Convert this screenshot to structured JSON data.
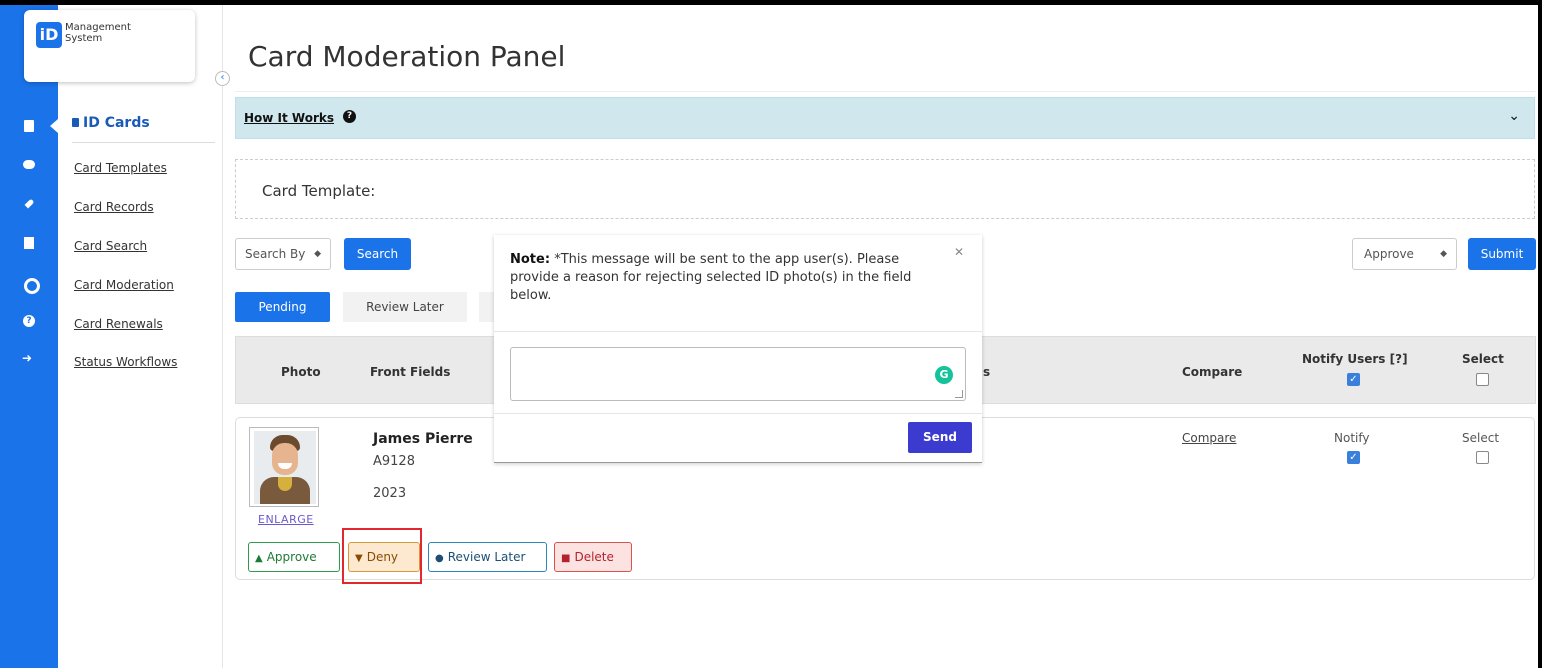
{
  "brand": {
    "logo_mark": "iD",
    "logo_text": "Management System"
  },
  "sidebar": {
    "section_title": "ID Cards",
    "items": [
      {
        "label": "Card Templates"
      },
      {
        "label": "Card Records"
      },
      {
        "label": "Card Search"
      },
      {
        "label": "Card Moderation"
      },
      {
        "label": "Card Renewals"
      },
      {
        "label": "Status Workflows"
      }
    ],
    "rail_icons": [
      "id-card-icon",
      "chat-icon",
      "rocket-icon",
      "file-icon",
      "gear-icon",
      "help-icon",
      "logout-icon"
    ]
  },
  "page": {
    "title": "Card Moderation Panel"
  },
  "how_it_works": {
    "label": "How It Works"
  },
  "card_template": {
    "label": "Card Template:"
  },
  "toolbar": {
    "search_by": "Search By",
    "search_label": "Search",
    "action_select": "Approve",
    "submit_label": "Submit"
  },
  "tabs": [
    {
      "label": "Pending",
      "active": true
    },
    {
      "label": "Review Later",
      "active": false
    }
  ],
  "table": {
    "headers": {
      "photo": "Photo",
      "front_fields": "Front Fields",
      "partial_col": "s",
      "compare": "Compare",
      "notify_users": "Notify Users [?]",
      "select": "Select"
    },
    "header_notify_checked": true,
    "header_select_checked": false
  },
  "record": {
    "name": "James Pierre",
    "id": "A9128",
    "year": "2023",
    "enlarge_label": "ENLARGE",
    "compare_label": "Compare",
    "notify_label": "Notify",
    "notify_checked": true,
    "select_label": "Select",
    "select_checked": false,
    "actions": {
      "approve": "Approve",
      "deny": "Deny",
      "review_later": "Review Later",
      "delete": "Delete"
    }
  },
  "popover": {
    "note_label": "Note:",
    "note_text": "*This message will be sent to the app user(s). Please provide a reason for rejecting selected ID photo(s) in the field below.",
    "textarea_value": "",
    "send_label": "Send"
  },
  "colors": {
    "primary": "#1a73e8",
    "info_bar": "#cfe7ed",
    "send": "#3b3bd0",
    "highlight": "#e0282e"
  }
}
